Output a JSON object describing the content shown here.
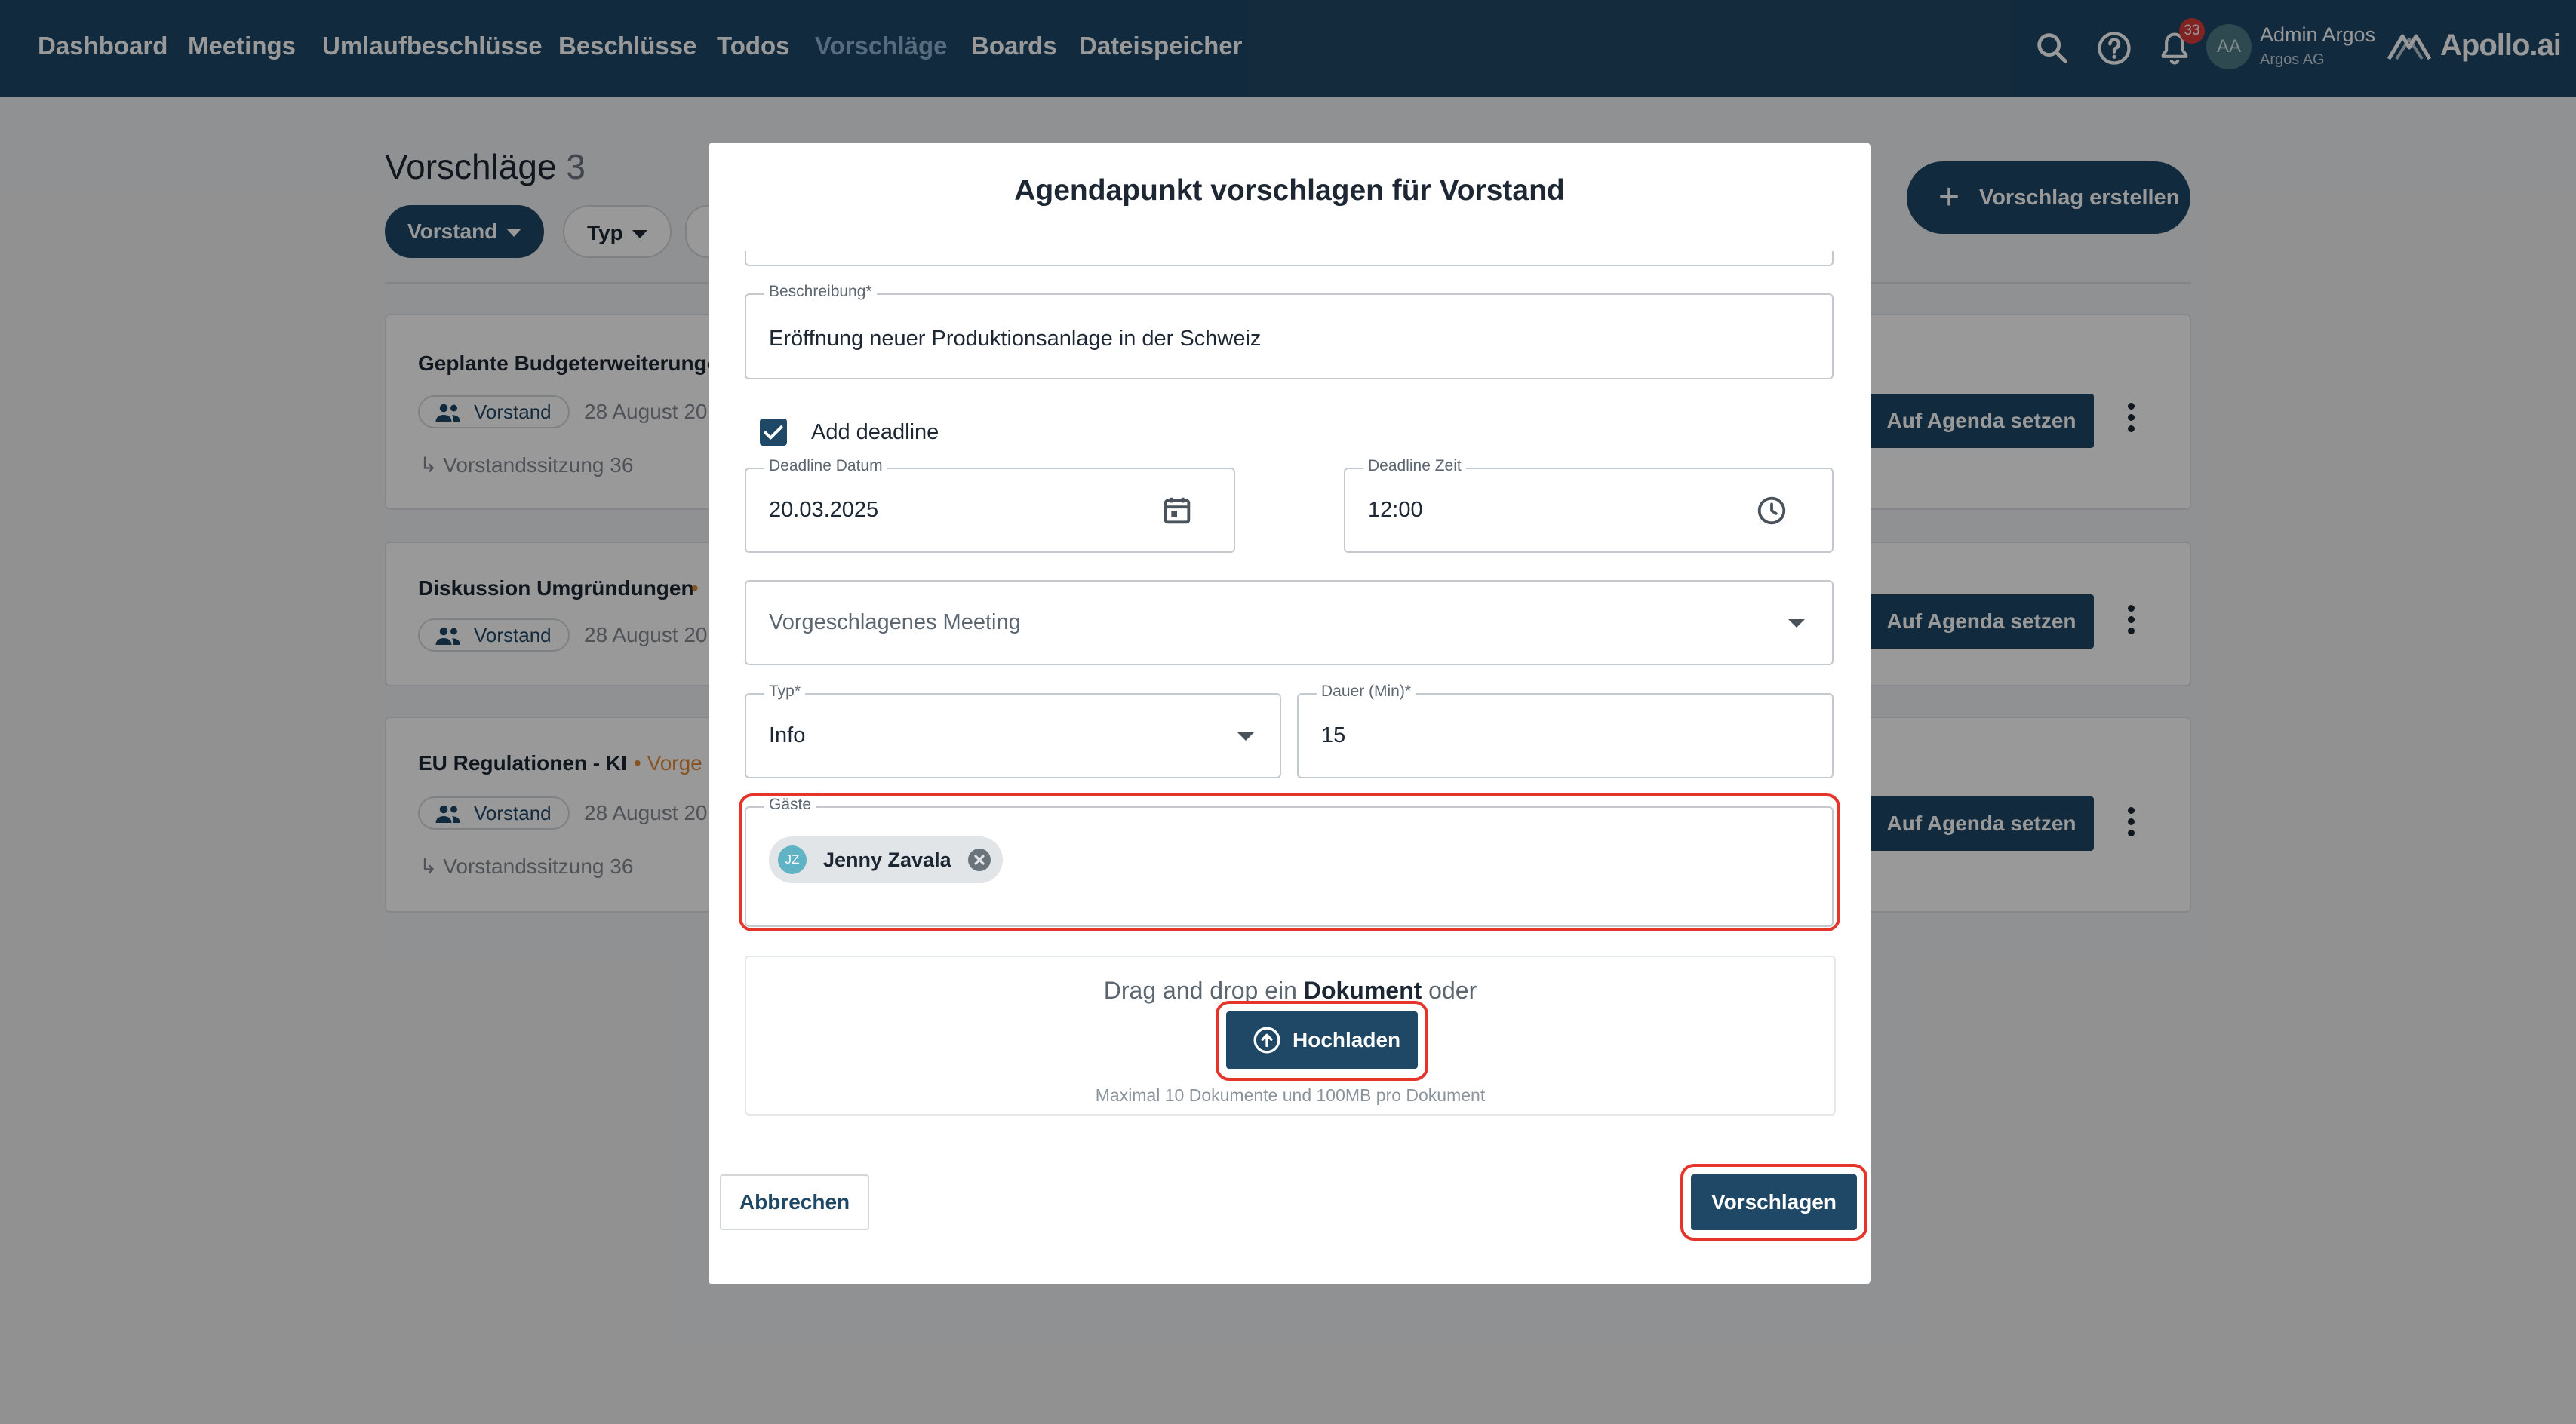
{
  "nav": {
    "items": [
      "Dashboard",
      "Meetings",
      "Umlaufbeschlüsse",
      "Beschlüsse",
      "Todos",
      "Vorschläge",
      "Boards",
      "Dateispeicher"
    ],
    "active_index": 5,
    "notification_count": "33",
    "user_initials": "AA",
    "user_name": "Admin Argos",
    "user_org": "Argos AG",
    "logo_text": "Apollo.ai",
    "icons": [
      "search-icon",
      "help-icon",
      "bell-icon"
    ]
  },
  "page": {
    "title": "Vorschläge",
    "count": "3",
    "filters": [
      "Vorstand",
      "Typ"
    ],
    "create_label": "Vorschlag erstellen",
    "cards": [
      {
        "title": "Geplante Budgeterweiterungen",
        "group": "Vorstand",
        "date": "28 August 20",
        "sub": "Vorstandssitzung 36",
        "status": "",
        "action": "Auf Agenda setzen"
      },
      {
        "title": "Diskussion Umgründungen",
        "group": "Vorstand",
        "date": "28 August 20",
        "sub": "",
        "status": "•",
        "action": "Auf Agenda setzen"
      },
      {
        "title": "EU Regulationen - KI",
        "group": "Vorstand",
        "date": "28 August 20",
        "sub": "Vorstandssitzung 36",
        "status": "• Vorge",
        "action": "Auf Agenda setzen"
      }
    ]
  },
  "dialog": {
    "title": "Agendapunkt vorschlagen für Vorstand",
    "description_label": "Beschreibung*",
    "description_value": "Eröffnung neuer Produktionsanlage in der Schweiz",
    "deadline_checkbox_label": "Add deadline",
    "deadline_checked": true,
    "deadline_date_label": "Deadline Datum",
    "deadline_date_value": "20.03.2025",
    "deadline_time_label": "Deadline Zeit",
    "deadline_time_value": "12:00",
    "meeting_placeholder": "Vorgeschlagenes Meeting",
    "type_label": "Typ*",
    "type_value": "Info",
    "duration_label": "Dauer (Min)*",
    "duration_value": "15",
    "guests_label": "Gäste",
    "guests": [
      {
        "initials": "JZ",
        "name": "Jenny Zavala"
      }
    ],
    "drop_text_prefix": "Drag and drop ein",
    "drop_text_bold": "Dokument",
    "drop_text_suffix": "oder",
    "upload_label": "Hochladen",
    "upload_hint": "Maximal 10 Dokumente und 100MB pro Dokument",
    "cancel_label": "Abbrechen",
    "submit_label": "Vorschlagen"
  },
  "colors": {
    "primary": "#1f4766",
    "highlight": "#e5352b",
    "status_orange": "#e0893a",
    "badge": "#d93b3b"
  }
}
